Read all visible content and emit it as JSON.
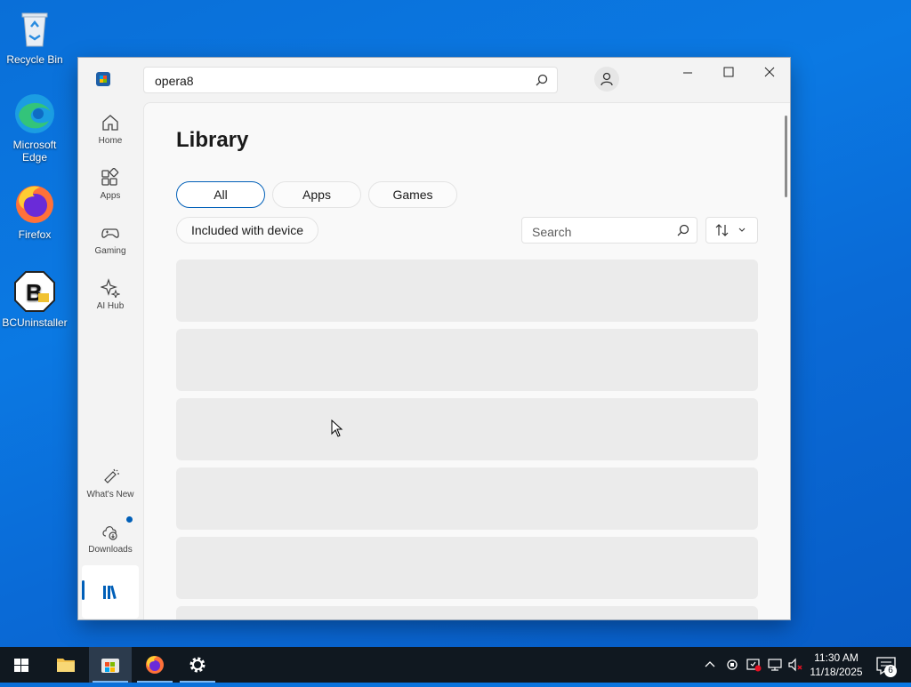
{
  "desktop": {
    "icons": [
      {
        "label": "Recycle Bin"
      },
      {
        "label": "Microsoft Edge"
      },
      {
        "label": "Firefox"
      },
      {
        "label": "BCUninstaller"
      }
    ]
  },
  "store": {
    "search_value": "opera8",
    "sidebar": {
      "items": [
        {
          "label": "Home",
          "icon": "home-icon"
        },
        {
          "label": "Apps",
          "icon": "apps-icon"
        },
        {
          "label": "Gaming",
          "icon": "gamepad-icon"
        },
        {
          "label": "AI Hub",
          "icon": "sparkle-icon"
        },
        {
          "label": "What's New",
          "icon": "megaphone-icon"
        },
        {
          "label": "Downloads",
          "icon": "cloud-download-icon"
        },
        {
          "label": "",
          "icon": "library-icon"
        }
      ]
    },
    "library": {
      "title": "Library",
      "filters": [
        "All",
        "Apps",
        "Games",
        "Included with device"
      ],
      "selected_filter": "All",
      "search_placeholder": "Search"
    }
  },
  "taskbar": {
    "time": "11:30 AM",
    "date": "11/18/2025",
    "notification_count": "6"
  },
  "colors": {
    "accent": "#005fb8",
    "desktop": "#0a6fd8",
    "taskbar": "#101820"
  }
}
